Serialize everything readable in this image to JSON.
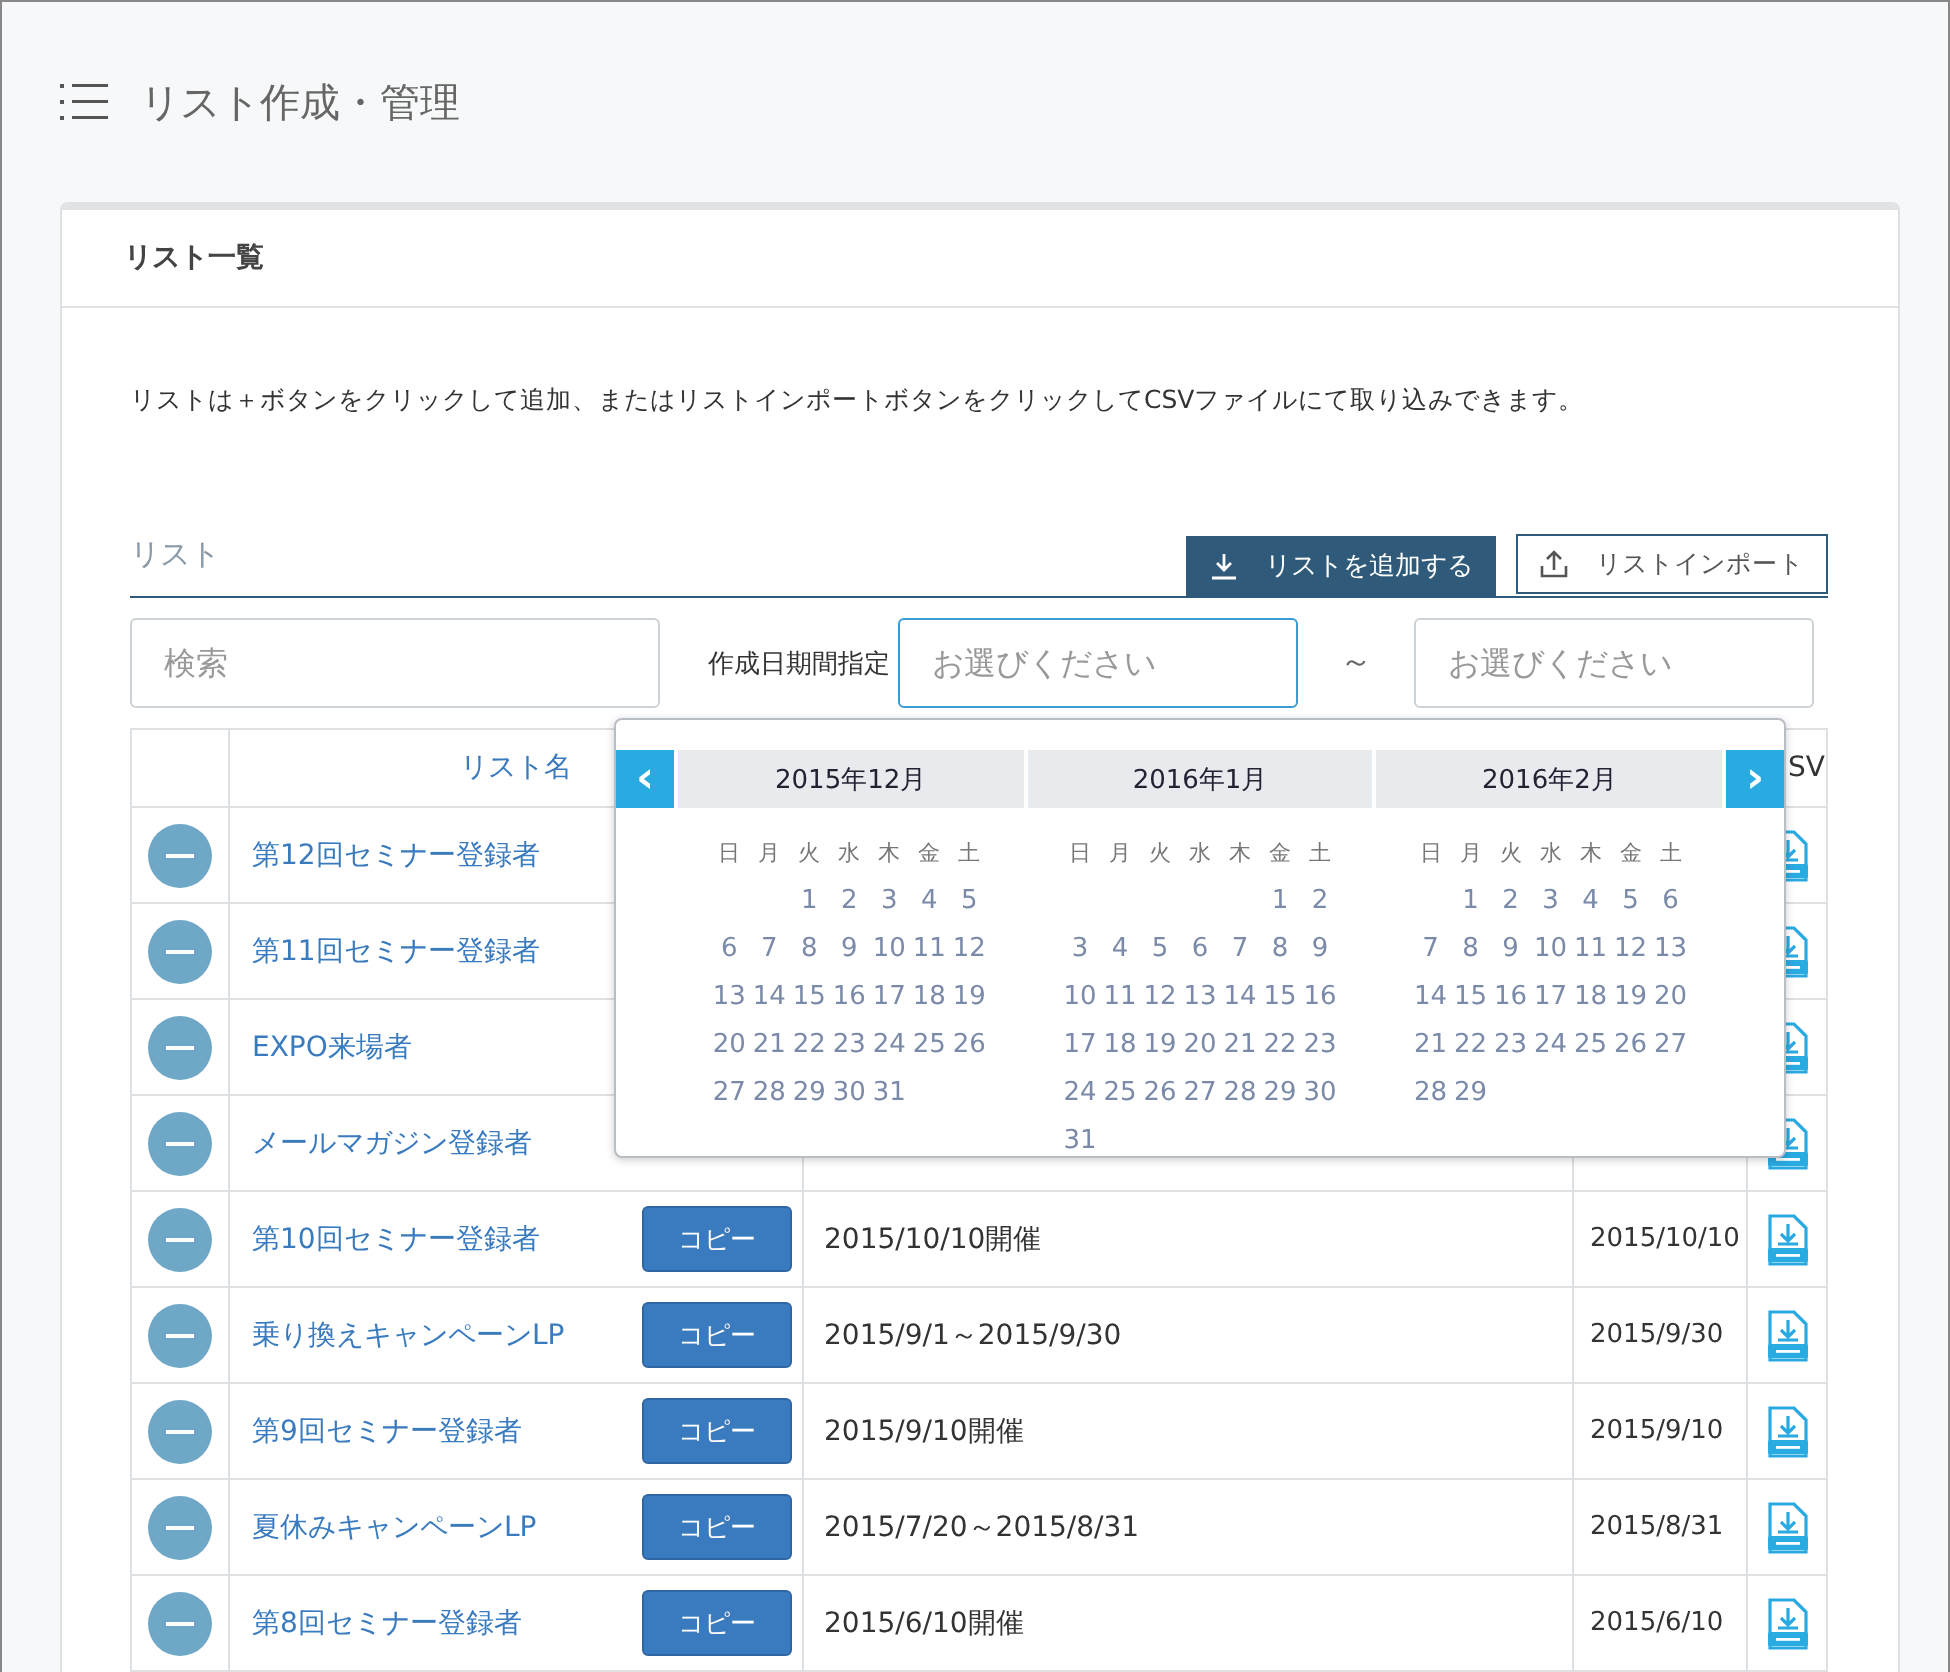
{
  "page": {
    "title": "リスト作成・管理"
  },
  "card": {
    "title": "リスト一覧",
    "description": "リストは＋ボタンをクリックして追加、またはリストインポートボタンをクリックしてCSVファイルにて取り込みできます。"
  },
  "section": {
    "label": "リスト",
    "add_button": "リストを追加する",
    "import_button": "リストインポート"
  },
  "filters": {
    "search_placeholder": "検索",
    "date_label": "作成日期間指定",
    "from_placeholder": "お選びください",
    "from_focused": true,
    "separator": "～",
    "to_placeholder": "お選びください",
    "to_focused": false
  },
  "table": {
    "columns": [
      {
        "label": "リスト名"
      },
      {
        "label": "SV"
      }
    ],
    "rows": [
      {
        "name": "第12回セミナー登録者"
      },
      {
        "name": "第11回セミナー登録者"
      },
      {
        "name": "EXPO来場者"
      },
      {
        "name": "メールマガジン登録者"
      },
      {
        "name": "第10回セミナー登録者",
        "copy": "コピー",
        "description": "2015/10/10開催",
        "date": "2015/10/10"
      },
      {
        "name": "乗り換えキャンペーンLP",
        "copy": "コピー",
        "description": "2015/9/1～2015/9/30",
        "date": "2015/9/30"
      },
      {
        "name": "第9回セミナー登録者",
        "copy": "コピー",
        "description": "2015/9/10開催",
        "date": "2015/9/10"
      },
      {
        "name": "夏休みキャンペーンLP",
        "copy": "コピー",
        "description": "2015/7/20～2015/8/31",
        "date": "2015/8/31"
      },
      {
        "name": "第8回セミナー登録者",
        "copy": "コピー",
        "description": "2015/6/10開催",
        "date": "2015/6/10"
      }
    ]
  },
  "calendar": {
    "prev": "‹",
    "next": "›",
    "months": [
      {
        "title": "2015年12月",
        "weekdays": [
          "日",
          "月",
          "火",
          "水",
          "木",
          "金",
          "土"
        ],
        "weeks": [
          {
            "starts_midweek": true,
            "days": [
              "1",
              "2",
              "3",
              "4",
              "5"
            ]
          },
          {
            "days": [
              "6",
              "7",
              "8",
              "9",
              "10",
              "11",
              "12"
            ]
          },
          {
            "days": [
              "13",
              "14",
              "15",
              "16",
              "17",
              "18",
              "19"
            ]
          },
          {
            "days": [
              "20",
              "21",
              "22",
              "23",
              "24",
              "25",
              "26"
            ]
          },
          {
            "days": [
              "27",
              "28",
              "29",
              "30",
              "31"
            ]
          }
        ]
      },
      {
        "title": "2016年1月",
        "weekdays": [
          "日",
          "月",
          "火",
          "水",
          "木",
          "金",
          "土"
        ],
        "weeks": [
          {
            "starts_midweek": true,
            "days": [
              "1",
              "2"
            ]
          },
          {
            "days": [
              "3",
              "4",
              "5",
              "6",
              "7",
              "8",
              "9"
            ]
          },
          {
            "days": [
              "10",
              "11",
              "12",
              "13",
              "14",
              "15",
              "16"
            ]
          },
          {
            "days": [
              "17",
              "18",
              "19",
              "20",
              "21",
              "22",
              "23"
            ]
          },
          {
            "days": [
              "24",
              "25",
              "26",
              "27",
              "28",
              "29",
              "30"
            ]
          },
          {
            "days": [
              "31"
            ]
          }
        ]
      },
      {
        "title": "2016年2月",
        "weekdays": [
          "日",
          "月",
          "火",
          "水",
          "木",
          "金",
          "土"
        ],
        "weeks": [
          {
            "starts_midweek": true,
            "days": [
              "1",
              "2",
              "3",
              "4",
              "5",
              "6"
            ]
          },
          {
            "days": [
              "7",
              "8",
              "9",
              "10",
              "11",
              "12",
              "13"
            ]
          },
          {
            "days": [
              "14",
              "15",
              "16",
              "17",
              "18",
              "19",
              "20"
            ]
          },
          {
            "days": [
              "21",
              "22",
              "23",
              "24",
              "25",
              "26",
              "27"
            ]
          },
          {
            "days": [
              "28",
              "29"
            ]
          }
        ]
      }
    ]
  }
}
